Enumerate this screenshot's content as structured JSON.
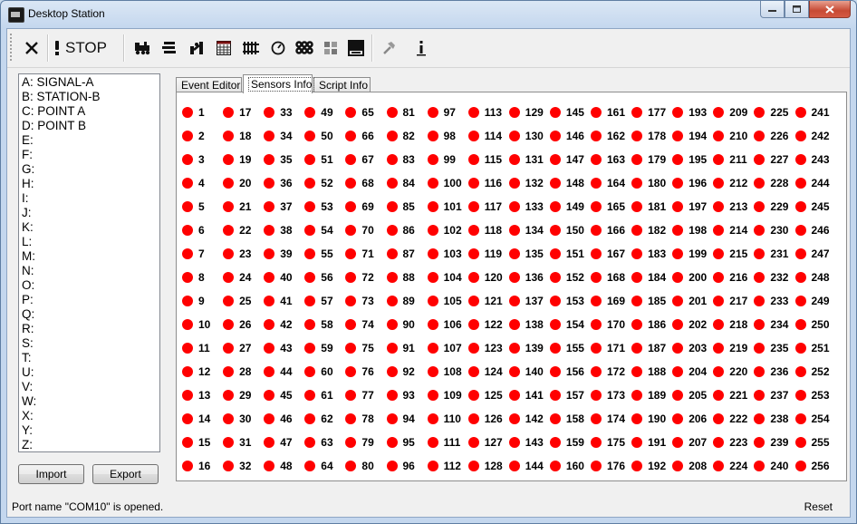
{
  "window": {
    "title": "Desktop Station"
  },
  "toolbar": {
    "stop_label": "STOP",
    "icons": [
      "close-icon",
      "stop-icon",
      "locomotive-icon",
      "list-icon",
      "accessory-icon",
      "layout-icon",
      "rail-icon",
      "clock-icon",
      "sensors-icon",
      "grid-icon",
      "script-icon",
      "tools-icon",
      "info-icon"
    ]
  },
  "sidebar": {
    "items": [
      "A: SIGNAL-A",
      "B: STATION-B",
      "C: POINT A",
      "D: POINT B",
      "E:",
      "F:",
      "G:",
      "H:",
      "I:",
      "J:",
      "K:",
      "L:",
      "M:",
      "N:",
      "O:",
      "P:",
      "Q:",
      "R:",
      "S:",
      "T:",
      "U:",
      "V:",
      "W:",
      "X:",
      "Y:",
      "Z:"
    ],
    "import_label": "Import",
    "export_label": "Export"
  },
  "tabs": [
    "Event Editor",
    "Sensors Info",
    "Script Info"
  ],
  "active_tab": "Sensors Info",
  "sensors": {
    "count": 256,
    "per_column": 16,
    "state_color": "#ff0000"
  },
  "status": {
    "message": "Port name \"COM10\" is opened.",
    "reset_label": "Reset"
  }
}
